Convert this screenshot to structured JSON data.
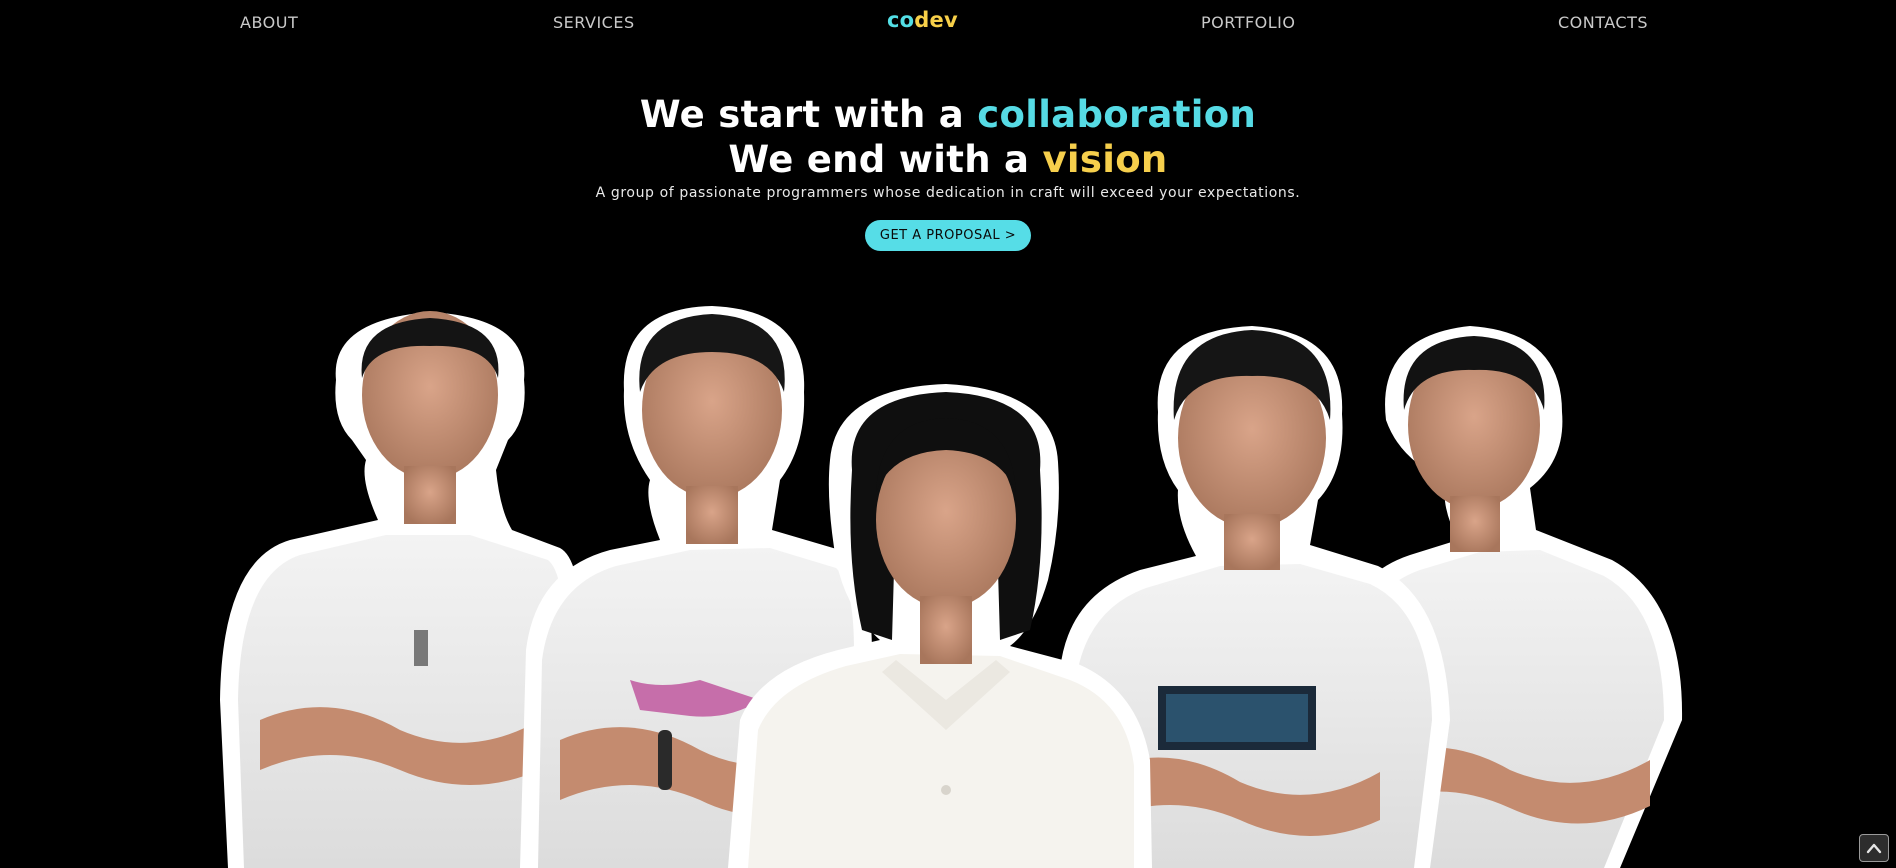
{
  "nav": {
    "about": "ABOUT",
    "services": "SERVICES",
    "logo_co": "co",
    "logo_dev": "dev",
    "portfolio": "PORTFOLIO",
    "contacts": "CONTACTS"
  },
  "hero": {
    "line1_prefix": "We start with a ",
    "line1_highlight": "collaboration",
    "line2_prefix": "We end with a ",
    "line2_highlight": "vision",
    "subtitle": "A group of passionate programmers whose dedication in craft will exceed your expectations.",
    "cta_label": "GET A PROPOSAL >"
  },
  "team": {
    "member_count": 5
  },
  "colors": {
    "background": "#000000",
    "accent_cyan": "#56dbe5",
    "accent_yellow": "#f6cf4c",
    "nav_text": "#c9c9c9"
  },
  "icons": {
    "scroll_top": "chevron-up-icon"
  }
}
